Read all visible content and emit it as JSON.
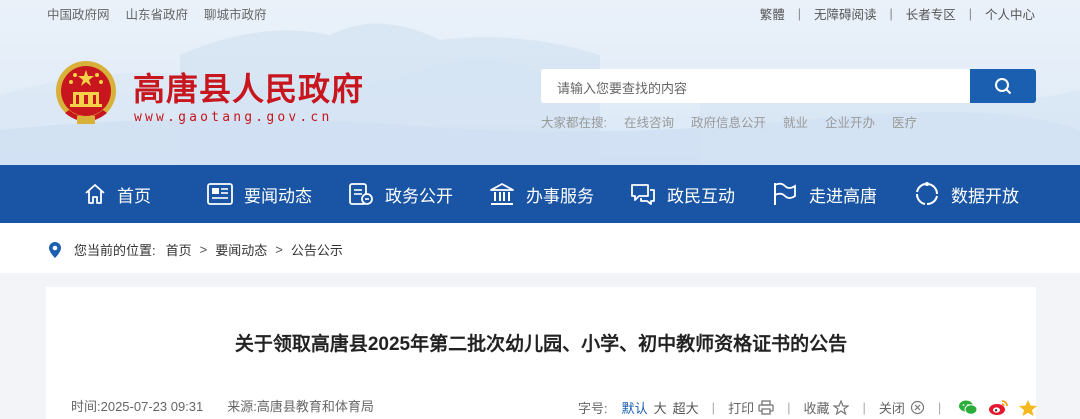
{
  "top_links": [
    "中国政府网",
    "山东省政府",
    "聊城市政府"
  ],
  "right_links": [
    "繁體",
    "无障碍阅读",
    "长者专区",
    "个人中心"
  ],
  "site": {
    "title": "高唐县人民政府",
    "url": "www.gaotang.gov.cn"
  },
  "search": {
    "placeholder": "请输入您要查找的内容",
    "hot_label": "大家都在搜:",
    "hot_words": [
      "在线咨询",
      "政府信息公开",
      "就业",
      "企业开办",
      "医疗"
    ]
  },
  "nav": [
    {
      "label": "首页",
      "icon": "home-icon"
    },
    {
      "label": "要闻动态",
      "icon": "newspaper-icon"
    },
    {
      "label": "政务公开",
      "icon": "document-icon"
    },
    {
      "label": "办事服务",
      "icon": "building-icon"
    },
    {
      "label": "政民互动",
      "icon": "chat-icon"
    },
    {
      "label": "走进高唐",
      "icon": "flag-icon"
    },
    {
      "label": "数据开放",
      "icon": "data-icon"
    }
  ],
  "breadcrumb": {
    "label": "您当前的位置:",
    "items": [
      "首页",
      "要闻动态",
      "公告公示"
    ]
  },
  "article": {
    "title": "关于领取高唐县2025年第二批次幼儿园、小学、初中教师资格证书的公告",
    "time": "时间:2025-07-23 09:31",
    "source": "来源:高唐县教育和体育局"
  },
  "tools": {
    "font_label": "字号:",
    "font_sizes": [
      "默认",
      "大",
      "超大"
    ],
    "active_font": "默认",
    "print": "打印",
    "favorite": "收藏",
    "close": "关闭"
  },
  "colors": {
    "brand_red": "#c7161e",
    "nav_blue": "#1955a4",
    "accent_blue": "#1a5fb0"
  }
}
